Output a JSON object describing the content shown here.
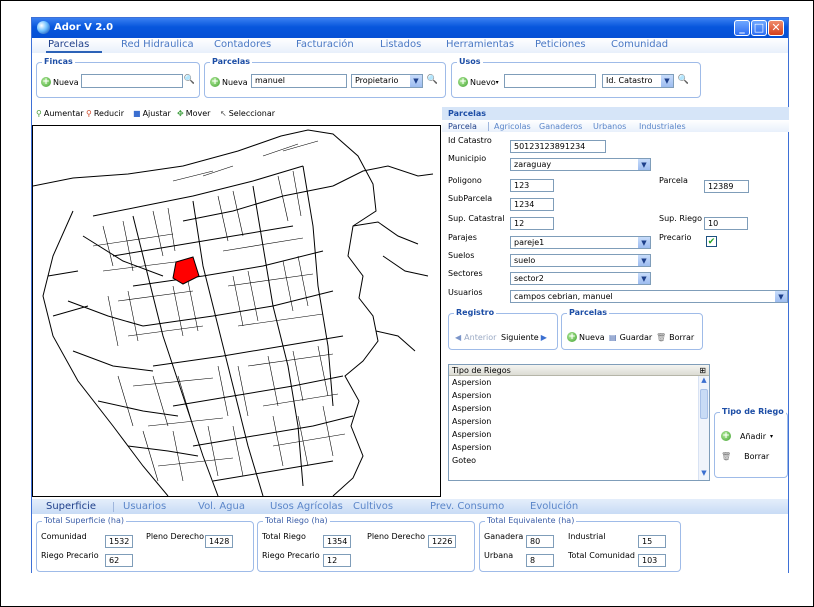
{
  "window": {
    "title": "Ador V 2.0",
    "minimize": "_",
    "maximize": "□",
    "close": "✕"
  },
  "menu": {
    "tabs": [
      "Parcelas",
      "Red Hidraulica",
      "Contadores",
      "Facturación",
      "Listados",
      "Herramientas",
      "Peticiones",
      "Comunidad"
    ],
    "active": "Parcelas"
  },
  "fincas": {
    "label": "Fincas",
    "new_label": "Nueva",
    "search_value": ""
  },
  "parcelas_search": {
    "label": "Parcelas",
    "new_label": "Nueva",
    "search_value": "manuel",
    "filter": "Propietario"
  },
  "usos": {
    "label": "Usos",
    "new_label": "Nuevo",
    "search_value": "",
    "filter": "Id. Catastro"
  },
  "map_toolbar": {
    "aumentar": "Aumentar",
    "reducir": "Reducir",
    "ajustar": "Ajustar",
    "mover": "Mover",
    "seleccionar": "Seleccionar"
  },
  "map": {
    "highlight_color": "#ff0000"
  },
  "parcela_panel": {
    "header": "Parcelas",
    "tabs": [
      "Parcela",
      "Agricolas",
      "Ganaderos",
      "Urbanos",
      "Industriales"
    ],
    "id_catastro_label": "Id Catastro",
    "id_catastro": "50123123891234",
    "municipio_label": "Municipio",
    "municipio": "zaraguay",
    "poligono_label": "Poligono",
    "poligono": "123",
    "parcela_label": "Parcela",
    "parcela": "12389",
    "subparcela_label": "SubParcela",
    "subparcela": "1234",
    "sup_catastral_label": "Sup. Catastral",
    "sup_catastral": "12",
    "sup_riego_label": "Sup. Riego",
    "sup_riego": "10",
    "parajes_label": "Parajes",
    "parajes": "pareje1",
    "precario_label": "Precario",
    "precario": "✔",
    "suelos_label": "Suelos",
    "suelos": "suelo",
    "sectores_label": "Sectores",
    "sectores": "sector2",
    "usuarios_label": "Usuarios",
    "usuarios": "campos cebrian, manuel"
  },
  "registro": {
    "label": "Registro",
    "anterior": "Anterior",
    "siguiente": "Siguiente"
  },
  "parcelas_actions": {
    "label": "Parcelas",
    "nueva": "Nueva",
    "guardar": "Guardar",
    "borrar": "Borrar"
  },
  "riegos": {
    "header": "Tipo de Riegos",
    "rows": [
      "Aspersion",
      "Aspersion",
      "Aspersion",
      "Aspersion",
      "Aspersion",
      "Aspersion",
      "Goteo"
    ]
  },
  "tipo_riego": {
    "label": "Tipo de Riego",
    "anadir": "Añadir",
    "borrar": "Borrar"
  },
  "bottom": {
    "tabs": [
      "Superficie",
      "Usuarios",
      "Vol. Agua",
      "Usos Agrícolas",
      "Cultivos",
      "Prev. Consumo",
      "Evolución"
    ],
    "total_superficie": {
      "label": "Total Superficie (ha)",
      "comunidad_label": "Comunidad",
      "comunidad": "1532",
      "pleno_label": "Pleno Derecho",
      "pleno": "1428",
      "precario_label": "Riego Precario",
      "precario": "62"
    },
    "total_riego": {
      "label": "Total Riego (ha)",
      "total_label": "Total Riego",
      "total": "1354",
      "pleno_label": "Pleno Derecho",
      "pleno": "1226",
      "precario_label": "Riego Precario",
      "precario": "12"
    },
    "total_equivalente": {
      "label": "Total Equivalente (ha)",
      "ganadera_label": "Ganadera",
      "ganadera": "80",
      "industrial_label": "Industrial",
      "industrial": "15",
      "urbana_label": "Urbana",
      "urbana": "8",
      "comunidad_label": "Total Comunidad",
      "comunidad": "103"
    }
  }
}
